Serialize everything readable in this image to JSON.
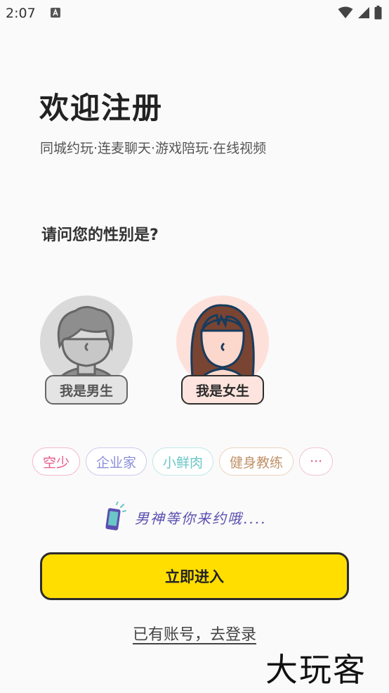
{
  "status_bar": {
    "time": "2:07"
  },
  "header": {
    "title": "欢迎注册",
    "subtitle": "同城约玩·连麦聊天·游戏陪玩·在线视频"
  },
  "gender": {
    "question": "请问您的性别是?",
    "male_label": "我是男生",
    "female_label": "我是女生"
  },
  "tags": [
    {
      "label": "空少",
      "color": "#e8578a",
      "border": "#f3b9cd"
    },
    {
      "label": "企业家",
      "color": "#8a8fd8",
      "border": "#c9cbee"
    },
    {
      "label": "小鲜肉",
      "color": "#6bc6c7",
      "border": "#bfe6e6"
    },
    {
      "label": "健身教练",
      "color": "#c0936a",
      "border": "#ead3bf"
    },
    {
      "label": "···",
      "color": "#e8578a",
      "border": "#f3c3d1"
    }
  ],
  "hint": {
    "text": "男神等你来约哦...."
  },
  "actions": {
    "enter_label": "立即进入",
    "login_label": "已有账号，去登录"
  },
  "watermark": {
    "text": "大玩客"
  },
  "colors": {
    "accent": "#ffde00",
    "male_bg": "#dadada",
    "female_bg": "#fde0da"
  }
}
